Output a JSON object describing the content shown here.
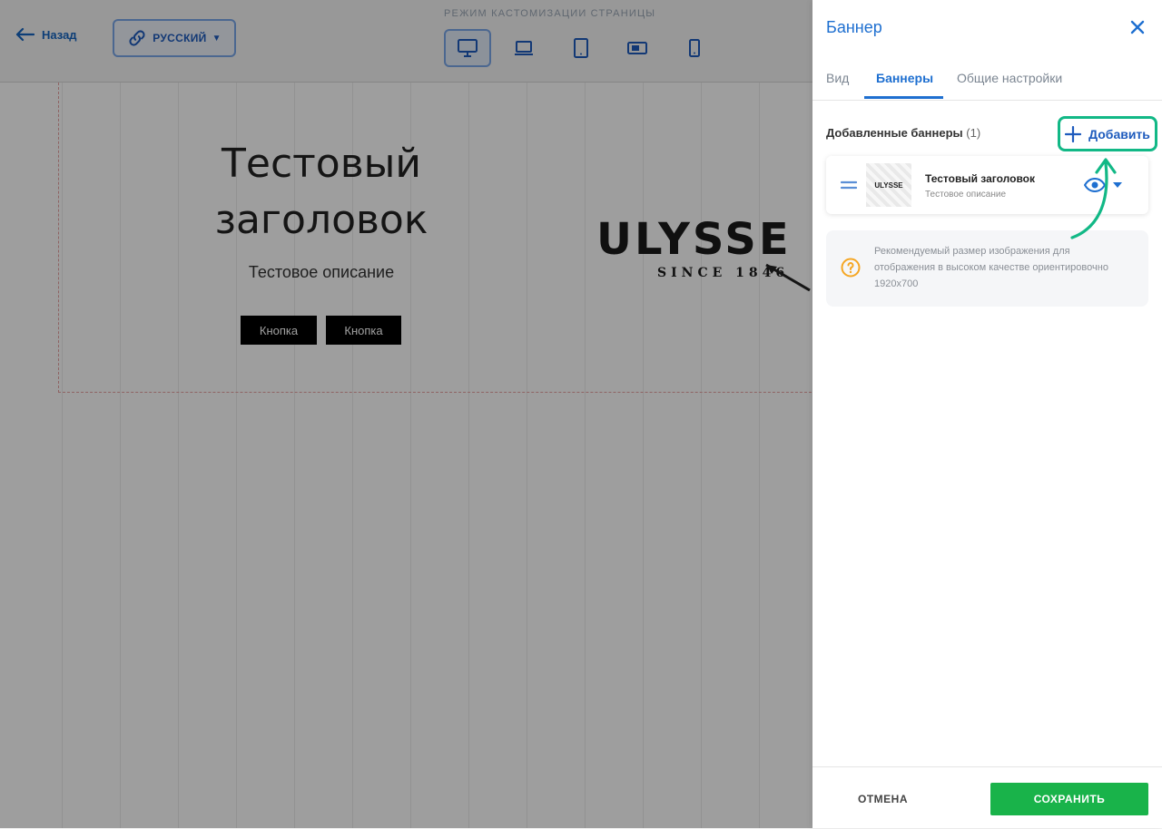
{
  "editor": {
    "back_label": "Назад",
    "language_label": "РУССКИЙ",
    "mode_title": "РЕЖИМ КАСТОМИЗАЦИИ СТРАНИЦЫ",
    "devices": [
      "desktop-icon",
      "laptop-icon",
      "tablet-icon",
      "tablet-landscape-icon",
      "mobile-icon"
    ],
    "active_device": "desktop",
    "banner": {
      "title_line1": "Тестовый",
      "title_line2": "заголовок",
      "description": "Тестовое описание",
      "button1": "Кнопка",
      "button2": "Кнопка",
      "brand": "ULYSSE",
      "brand_sub": "SINCE 1846"
    }
  },
  "panel": {
    "title": "Баннер",
    "tabs": [
      {
        "label": "Вид",
        "active": false
      },
      {
        "label": "Баннеры",
        "active": true
      },
      {
        "label": "Общие настройки",
        "active": false
      }
    ],
    "section_label": "Добавленные баннеры",
    "section_count": "(1)",
    "add_label": "Добавить",
    "banners": [
      {
        "title": "Тестовый заголовок",
        "description": "Тестовое описание",
        "thumb_text": "ULYSSE"
      }
    ],
    "info_text": "Рекомендуемый размер изображения для отображения в высоком качестве ориентировочно 1920х700",
    "cancel_label": "ОТМЕНА",
    "save_label": "СОХРАНИТЬ"
  },
  "colors": {
    "accent": "#1e6fd0",
    "highlight": "#12b886",
    "save": "#19b34a",
    "info": "#f5a623"
  }
}
